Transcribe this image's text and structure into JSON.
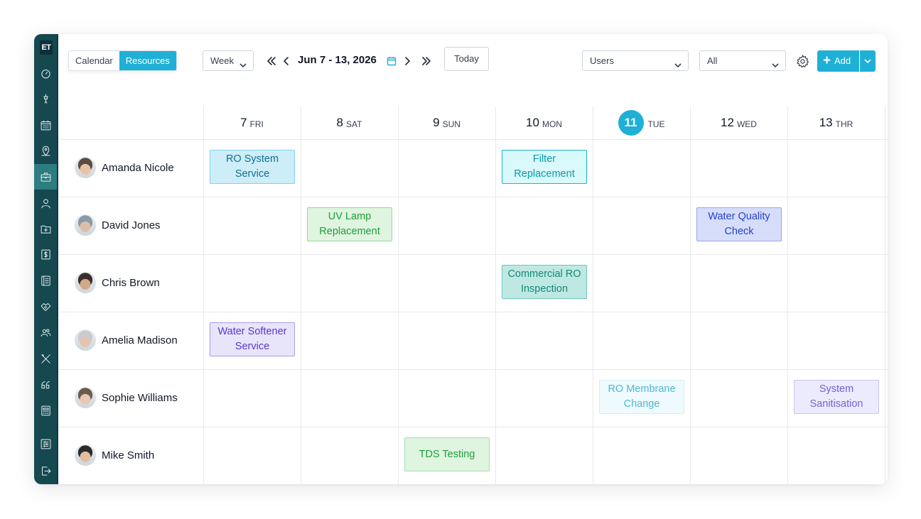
{
  "app": {
    "logo": "ET"
  },
  "sidebar": {
    "items": [
      {
        "name": "dashboard-icon"
      },
      {
        "name": "water-tap-icon"
      },
      {
        "name": "calendar-icon"
      },
      {
        "name": "map-pin-icon"
      },
      {
        "name": "briefcase-icon",
        "active": true
      },
      {
        "name": "user-icon"
      },
      {
        "name": "folder-plus-icon"
      },
      {
        "name": "dollar-icon"
      },
      {
        "name": "list-icon"
      },
      {
        "name": "handshake-icon"
      },
      {
        "name": "team-icon"
      },
      {
        "name": "tools-icon"
      },
      {
        "name": "quote-icon"
      },
      {
        "name": "calculator-icon"
      },
      {
        "name": "settings-sliders-icon"
      },
      {
        "name": "logout-icon"
      }
    ]
  },
  "toolbar": {
    "view_tabs": [
      "Calendar",
      "Resources"
    ],
    "active_view": "Resources",
    "period_select": "Week",
    "date_range": "Jun 7 - 13, 2026",
    "today_label": "Today",
    "users_select": "Users",
    "filter_select": "All",
    "add_label": "Add"
  },
  "days": [
    {
      "num": "7",
      "dow": "FRI"
    },
    {
      "num": "8",
      "dow": "SAT"
    },
    {
      "num": "9",
      "dow": "SUN"
    },
    {
      "num": "10",
      "dow": "MON"
    },
    {
      "num": "11",
      "dow": "TUE",
      "today": true
    },
    {
      "num": "12",
      "dow": "WED"
    },
    {
      "num": "13",
      "dow": "THR"
    }
  ],
  "resources": [
    {
      "name": "Amanda Nicole"
    },
    {
      "name": "David Jones"
    },
    {
      "name": "Chris Brown"
    },
    {
      "name": "Amelia Madison"
    },
    {
      "name": "Sophie Williams"
    },
    {
      "name": "Mike Smith"
    }
  ],
  "events": [
    {
      "title": "RO System Service",
      "resource": 0,
      "day": 0,
      "bg": "#cdeef9",
      "border": "#7fd0ec",
      "color": "#0e6f93"
    },
    {
      "title": "Filter Replacement",
      "resource": 0,
      "day": 3,
      "bg": "#d9f9fb",
      "border": "#19b8c6",
      "color": "#0d9aa8"
    },
    {
      "title": "UV Lamp Replacement",
      "resource": 1,
      "day": 1,
      "bg": "#dff5df",
      "border": "#8fd79a",
      "color": "#1f9c3c"
    },
    {
      "title": "Water Quality Check",
      "resource": 1,
      "day": 5,
      "bg": "#d5ddfb",
      "border": "#97a8ec",
      "color": "#2743c6"
    },
    {
      "title": "Commercial RO Inspection",
      "resource": 2,
      "day": 3,
      "bg": "#bfe8e2",
      "border": "#6cc7b9",
      "color": "#0f8a77"
    },
    {
      "title": "Water Softener Service",
      "resource": 3,
      "day": 0,
      "bg": "#e8e5fb",
      "border": "#a69ae8",
      "color": "#5b34d1"
    },
    {
      "title": "RO Membrane Change",
      "resource": 4,
      "day": 4,
      "bg": "#eefafd",
      "border": "#d0eef5",
      "color": "#4fb8d1"
    },
    {
      "title": "System Sanitisation",
      "resource": 4,
      "day": 6,
      "bg": "#eceafd",
      "border": "#c9c3f4",
      "color": "#6f63d8"
    },
    {
      "title": "TDS Testing",
      "resource": 5,
      "day": 2,
      "bg": "#dff5df",
      "border": "#a4dcae",
      "color": "#1f9c3c"
    }
  ]
}
